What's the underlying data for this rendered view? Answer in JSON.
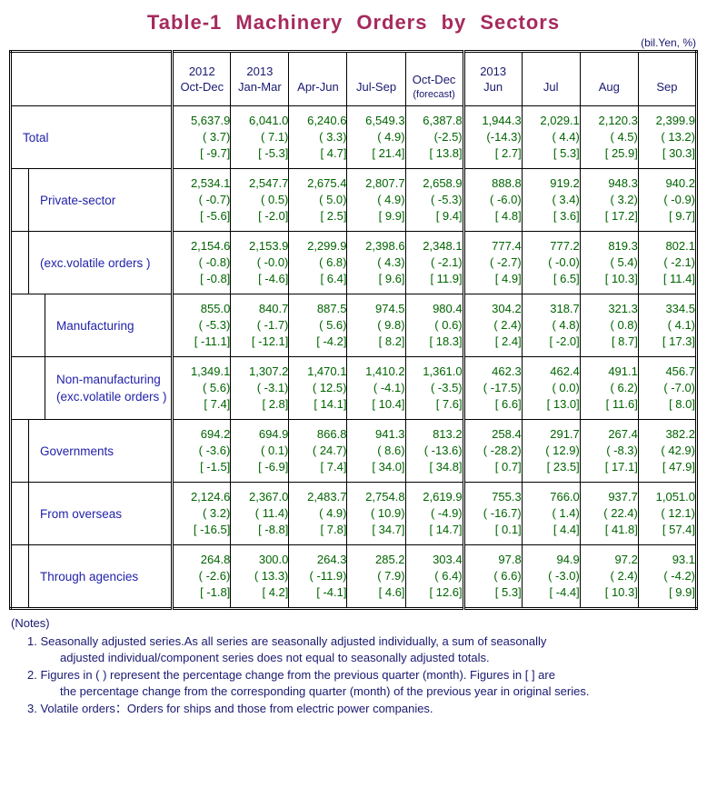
{
  "title": "Table-1  Machinery  Orders  by  Sectors",
  "unit": "(bil.Yen, %)",
  "header": {
    "corner": "",
    "columns": [
      {
        "year": "2012",
        "period": "Oct-Dec",
        "note": ""
      },
      {
        "year": "2013",
        "period": "Jan-Mar",
        "note": ""
      },
      {
        "year": "",
        "period": "Apr-Jun",
        "note": ""
      },
      {
        "year": "",
        "period": "Jul-Sep",
        "note": ""
      },
      {
        "year": "",
        "period": "Oct-Dec",
        "note": "(forecast)"
      },
      {
        "year": "2013",
        "period": "Jun",
        "note": ""
      },
      {
        "year": "",
        "period": "Jul",
        "note": ""
      },
      {
        "year": "",
        "period": "Aug",
        "note": ""
      },
      {
        "year": "",
        "period": "Sep",
        "note": ""
      }
    ]
  },
  "rows": [
    {
      "label": "Total",
      "label2": "",
      "level": 0,
      "values": [
        "5,637.9",
        "6,041.0",
        "6,240.6",
        "6,549.3",
        "6,387.8",
        "1,944.3",
        "2,029.1",
        "2,120.3",
        "2,399.9"
      ],
      "qoq": [
        "( 3.7)",
        "( 7.1)",
        "( 3.3)",
        "( 4.9)",
        "(-2.5)",
        "(-14.3)",
        "( 4.4)",
        "( 4.5)",
        "( 13.2)"
      ],
      "yoy": [
        "[ -9.7]",
        "[ -5.3]",
        "[ 4.7]",
        "[ 21.4]",
        "[ 13.8]",
        "[ 2.7]",
        "[ 5.3]",
        "[ 25.9]",
        "[ 30.3]"
      ]
    },
    {
      "label": "Private-sector",
      "label2": "",
      "level": 1,
      "values": [
        "2,534.1",
        "2,547.7",
        "2,675.4",
        "2,807.7",
        "2,658.9",
        "888.8",
        "919.2",
        "948.3",
        "940.2"
      ],
      "qoq": [
        "( -0.7)",
        "( 0.5)",
        "( 5.0)",
        "( 4.9)",
        "( -5.3)",
        "( -6.0)",
        "( 3.4)",
        "( 3.2)",
        "( -0.9)"
      ],
      "yoy": [
        "[ -5.6]",
        "[ -2.0]",
        "[ 2.5]",
        "[ 9.9]",
        "[ 9.4]",
        "[ 4.8]",
        "[ 3.6]",
        "[ 17.2]",
        "[ 9.7]"
      ]
    },
    {
      "label": "(exc.volatile orders )",
      "label2": "",
      "level": 1,
      "values": [
        "2,154.6",
        "2,153.9",
        "2,299.9",
        "2,398.6",
        "2,348.1",
        "777.4",
        "777.2",
        "819.3",
        "802.1"
      ],
      "qoq": [
        "( -0.8)",
        "( -0.0)",
        "( 6.8)",
        "( 4.3)",
        "( -2.1)",
        "( -2.7)",
        "( -0.0)",
        "( 5.4)",
        "( -2.1)"
      ],
      "yoy": [
        "[ -0.8]",
        "[ -4.6]",
        "[ 6.4]",
        "[ 9.6]",
        "[ 11.9]",
        "[ 4.9]",
        "[ 6.5]",
        "[ 10.3]",
        "[ 11.4]"
      ]
    },
    {
      "label": "Manufacturing",
      "label2": "",
      "level": 2,
      "values": [
        "855.0",
        "840.7",
        "887.5",
        "974.5",
        "980.4",
        "304.2",
        "318.7",
        "321.3",
        "334.5"
      ],
      "qoq": [
        "( -5.3)",
        "( -1.7)",
        "( 5.6)",
        "( 9.8)",
        "( 0.6)",
        "( 2.4)",
        "( 4.8)",
        "( 0.8)",
        "( 4.1)"
      ],
      "yoy": [
        "[ -11.1]",
        "[ -12.1]",
        "[ -4.2]",
        "[ 8.2]",
        "[ 18.3]",
        "[ 2.4]",
        "[ -2.0]",
        "[ 8.7]",
        "[ 17.3]"
      ]
    },
    {
      "label": "Non-manufacturing",
      "label2": "(exc.volatile orders )",
      "level": 2,
      "values": [
        "1,349.1",
        "1,307.2",
        "1,470.1",
        "1,410.2",
        "1,361.0",
        "462.3",
        "462.4",
        "491.1",
        "456.7"
      ],
      "qoq": [
        "( 5.6)",
        "( -3.1)",
        "( 12.5)",
        "( -4.1)",
        "( -3.5)",
        "( -17.5)",
        "( 0.0)",
        "( 6.2)",
        "( -7.0)"
      ],
      "yoy": [
        "[ 7.4]",
        "[ 2.8]",
        "[ 14.1]",
        "[ 10.4]",
        "[ 7.6]",
        "[ 6.6]",
        "[ 13.0]",
        "[ 11.6]",
        "[ 8.0]"
      ]
    },
    {
      "label": "Governments",
      "label2": "",
      "level": 1,
      "values": [
        "694.2",
        "694.9",
        "866.8",
        "941.3",
        "813.2",
        "258.4",
        "291.7",
        "267.4",
        "382.2"
      ],
      "qoq": [
        "( -3.6)",
        "( 0.1)",
        "( 24.7)",
        "( 8.6)",
        "( -13.6)",
        "( -28.2)",
        "( 12.9)",
        "( -8.3)",
        "( 42.9)"
      ],
      "yoy": [
        "[ -1.5]",
        "[ -6.9]",
        "[ 7.4]",
        "[ 34.0]",
        "[ 34.8]",
        "[ 0.7]",
        "[ 23.5]",
        "[ 17.1]",
        "[ 47.9]"
      ]
    },
    {
      "label": "From overseas",
      "label2": "",
      "level": 1,
      "values": [
        "2,124.6",
        "2,367.0",
        "2,483.7",
        "2,754.8",
        "2,619.9",
        "755.3",
        "766.0",
        "937.7",
        "1,051.0"
      ],
      "qoq": [
        "( 3.2)",
        "( 11.4)",
        "( 4.9)",
        "( 10.9)",
        "( -4.9)",
        "( -16.7)",
        "( 1.4)",
        "( 22.4)",
        "( 12.1)"
      ],
      "yoy": [
        "[ -16.5]",
        "[ -8.8]",
        "[ 7.8]",
        "[ 34.7]",
        "[ 14.7]",
        "[ 0.1]",
        "[ 4.4]",
        "[ 41.8]",
        "[ 57.4]"
      ]
    },
    {
      "label": "Through agencies",
      "label2": "",
      "level": 1,
      "values": [
        "264.8",
        "300.0",
        "264.3",
        "285.2",
        "303.4",
        "97.8",
        "94.9",
        "97.2",
        "93.1"
      ],
      "qoq": [
        "( -2.6)",
        "( 13.3)",
        "( -11.9)",
        "( 7.9)",
        "( 6.4)",
        "( 6.6)",
        "( -3.0)",
        "( 2.4)",
        "( -4.2)"
      ],
      "yoy": [
        "[ -1.8]",
        "[ 4.2]",
        "[ -4.1]",
        "[ 4.6]",
        "[ 12.6]",
        "[ 5.3]",
        "[ -4.4]",
        "[ 10.3]",
        "[ 9.9]"
      ]
    }
  ],
  "notes": {
    "heading": "(Notes)",
    "items": [
      {
        "num": "1.",
        "line1": "Seasonally adjusted series.As all series are seasonally adjusted individually, a sum of seasonally",
        "line2": "adjusted individual/component series does not equal to seasonally adjusted totals."
      },
      {
        "num": "2.",
        "line1": "Figures in ( ) represent the percentage change from the previous quarter (month). Figures in [ ] are",
        "line2": "the percentage change from the corresponding quarter (month) of the previous year in original series."
      },
      {
        "num": "3.",
        "line1": "Volatile orders：Orders for ships and those from electric power companies.",
        "line2": ""
      }
    ]
  },
  "colors": {
    "title": "#a62a5e",
    "label": "#2222aa",
    "value": "#006400",
    "header": "#191970"
  }
}
